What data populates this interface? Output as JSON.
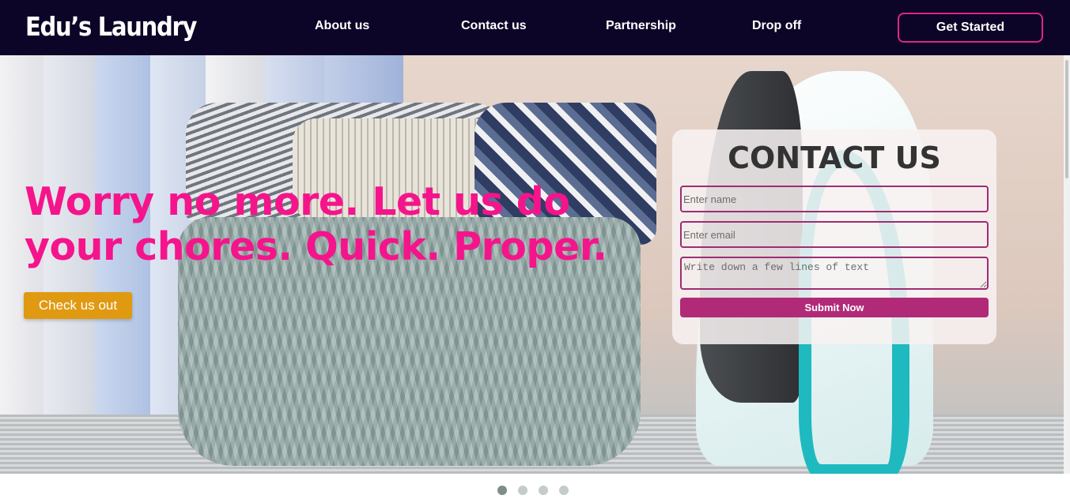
{
  "brand": {
    "name": "Edu’s Laundry"
  },
  "nav": {
    "links": [
      "About us",
      "Contact us",
      "Partnership",
      "Drop off"
    ],
    "cta_label": "Get Started"
  },
  "hero": {
    "headline": "Worry no more. Let us do your chores. Quick. Proper.",
    "button_label": "Check us out",
    "image": "laundry-basket-and-iron-photo"
  },
  "contact": {
    "title": "CONTACT US",
    "name_placeholder": "Enter name",
    "email_placeholder": "Enter email",
    "message_placeholder": "Write down a few lines of text",
    "submit_label": "Submit Now"
  },
  "carousel": {
    "slide_count": 4,
    "active_index": 1
  },
  "colors": {
    "navbar": "#0d0527",
    "accent_pink": "#f5148b",
    "button_orange": "#e09a12",
    "form_border": "#9e2d74",
    "submit": "#b12a78"
  }
}
